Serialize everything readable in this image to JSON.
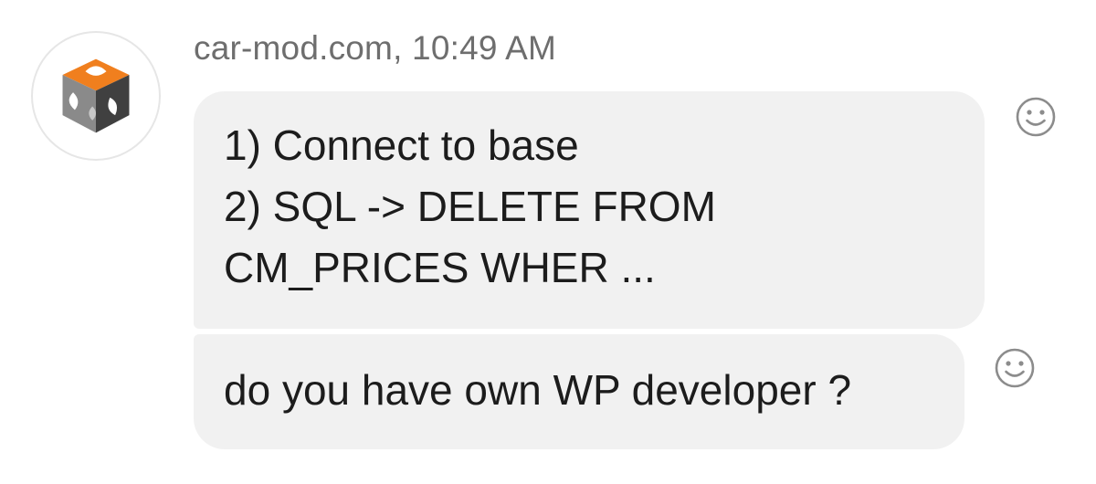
{
  "message_group": {
    "sender": "car-mod.com, 10:49 AM",
    "avatar_icon": "car-mod-cube-logo",
    "messages": [
      {
        "lines": [
          "1) Connect to base",
          "2) SQL -> DELETE FROM",
          "CM_PRICES WHER ..."
        ],
        "reaction_icon": "smiley-icon"
      },
      {
        "lines": [
          "do you have own WP developer ?"
        ],
        "reaction_icon": "smiley-icon"
      }
    ]
  },
  "colors": {
    "bubble_background": "#f1f1f1",
    "message_text": "#1c1c1c",
    "sender_text": "#6e6e6e",
    "logo_orange": "#f07f1e",
    "logo_dark": "#404040",
    "logo_gray": "#8a8a8a",
    "icon_gray": "#8c8c8c"
  }
}
